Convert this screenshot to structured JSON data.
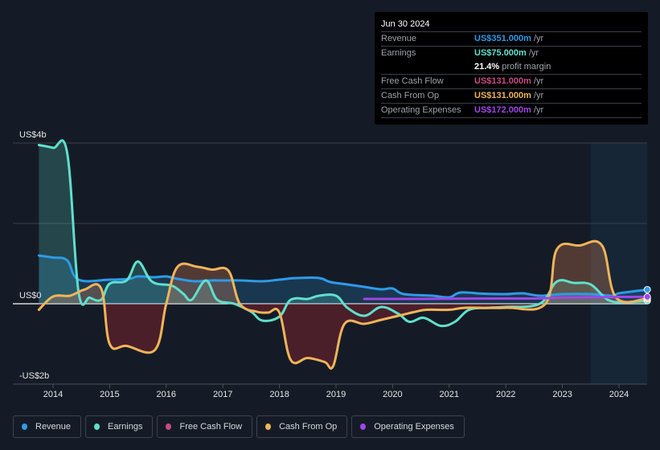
{
  "tooltip": {
    "date": "Jun 30 2024",
    "rows": [
      {
        "label": "Revenue",
        "value": "US$351.000m",
        "unit": "/yr",
        "color": "#2d9be8"
      },
      {
        "label": "Earnings",
        "value": "US$75.000m",
        "unit": "/yr",
        "color": "#5fe0cd"
      },
      {
        "label": "",
        "value": "21.4%",
        "unit": "profit margin",
        "color": "#ffffff"
      },
      {
        "label": "Free Cash Flow",
        "value": "US$131.000m",
        "unit": "/yr",
        "color": "#c94a84"
      },
      {
        "label": "Cash From Op",
        "value": "US$131.000m",
        "unit": "/yr",
        "color": "#f0b45a"
      },
      {
        "label": "Operating Expenses",
        "value": "US$172.000m",
        "unit": "/yr",
        "color": "#a046e8"
      }
    ]
  },
  "legend": [
    {
      "label": "Revenue",
      "color": "#2d9be8"
    },
    {
      "label": "Earnings",
      "color": "#5fe0cd"
    },
    {
      "label": "Free Cash Flow",
      "color": "#c94a84"
    },
    {
      "label": "Cash From Op",
      "color": "#f0b45a"
    },
    {
      "label": "Operating Expenses",
      "color": "#a046e8"
    }
  ],
  "chart_data": {
    "type": "area",
    "title": "",
    "xlabel": "",
    "ylabel": "",
    "units": "US$ billions",
    "ylim": [
      -2,
      4
    ],
    "xlim": [
      2013.75,
      2024.5
    ],
    "y_tick_labels": [
      {
        "value": 4,
        "label": "US$4b"
      },
      {
        "value": 0,
        "label": "US$0"
      },
      {
        "value": -2,
        "label": "-US$2b"
      }
    ],
    "gridlines": [
      4,
      2,
      0,
      -2
    ],
    "x_ticks": [
      2014,
      2015,
      2016,
      2017,
      2018,
      2019,
      2020,
      2021,
      2022,
      2023,
      2024
    ],
    "highlight_range": [
      2023.5,
      2024.5
    ],
    "legend_position": "bottom-left",
    "series": [
      {
        "name": "Revenue",
        "color": "#2d9be8",
        "fill": true,
        "points": [
          [
            2013.75,
            1.2
          ],
          [
            2014.0,
            1.15
          ],
          [
            2014.25,
            1.08
          ],
          [
            2014.45,
            0.6
          ],
          [
            2015.0,
            0.6
          ],
          [
            2015.35,
            0.62
          ],
          [
            2015.5,
            0.68
          ],
          [
            2015.8,
            0.66
          ],
          [
            2016.0,
            0.68
          ],
          [
            2016.2,
            0.62
          ],
          [
            2016.5,
            0.56
          ],
          [
            2016.8,
            0.58
          ],
          [
            2017.0,
            0.58
          ],
          [
            2017.3,
            0.58
          ],
          [
            2017.7,
            0.56
          ],
          [
            2018.0,
            0.6
          ],
          [
            2018.3,
            0.64
          ],
          [
            2018.7,
            0.64
          ],
          [
            2018.9,
            0.54
          ],
          [
            2019.2,
            0.48
          ],
          [
            2019.5,
            0.42
          ],
          [
            2019.8,
            0.36
          ],
          [
            2020.0,
            0.38
          ],
          [
            2020.2,
            0.24
          ],
          [
            2020.7,
            0.2
          ],
          [
            2021.0,
            0.16
          ],
          [
            2021.2,
            0.28
          ],
          [
            2021.6,
            0.25
          ],
          [
            2022.0,
            0.24
          ],
          [
            2022.3,
            0.26
          ],
          [
            2022.6,
            0.2
          ],
          [
            2023.0,
            0.24
          ],
          [
            2023.5,
            0.24
          ],
          [
            2023.9,
            0.2
          ],
          [
            2024.0,
            0.26
          ],
          [
            2024.5,
            0.351
          ]
        ]
      },
      {
        "name": "Earnings",
        "color": "#5fe0cd",
        "fill": true,
        "points": [
          [
            2013.75,
            3.95
          ],
          [
            2014.0,
            3.88
          ],
          [
            2014.25,
            3.75
          ],
          [
            2014.45,
            0.3
          ],
          [
            2014.65,
            0.15
          ],
          [
            2014.85,
            0.1
          ],
          [
            2015.0,
            0.5
          ],
          [
            2015.3,
            0.58
          ],
          [
            2015.5,
            1.05
          ],
          [
            2015.75,
            0.55
          ],
          [
            2016.1,
            0.45
          ],
          [
            2016.3,
            0.25
          ],
          [
            2016.45,
            0.1
          ],
          [
            2016.7,
            0.58
          ],
          [
            2016.9,
            0.1
          ],
          [
            2017.2,
            0.0
          ],
          [
            2017.5,
            -0.2
          ],
          [
            2017.7,
            -0.42
          ],
          [
            2018.0,
            -0.32
          ],
          [
            2018.2,
            0.1
          ],
          [
            2018.5,
            0.12
          ],
          [
            2018.7,
            0.2
          ],
          [
            2019.0,
            0.2
          ],
          [
            2019.2,
            -0.1
          ],
          [
            2019.5,
            -0.3
          ],
          [
            2019.8,
            -0.08
          ],
          [
            2020.1,
            -0.25
          ],
          [
            2020.3,
            -0.45
          ],
          [
            2020.55,
            -0.35
          ],
          [
            2020.85,
            -0.55
          ],
          [
            2021.1,
            -0.45
          ],
          [
            2021.35,
            -0.15
          ],
          [
            2021.7,
            -0.1
          ],
          [
            2022.0,
            -0.08
          ],
          [
            2022.6,
            0.0
          ],
          [
            2022.9,
            0.55
          ],
          [
            2023.2,
            0.52
          ],
          [
            2023.5,
            0.48
          ],
          [
            2023.8,
            0.1
          ],
          [
            2024.1,
            0.04
          ],
          [
            2024.5,
            0.075
          ]
        ]
      },
      {
        "name": "Free Cash Flow",
        "color": "#c94a84",
        "fill": true,
        "points": [
          [
            2013.75,
            -0.15
          ],
          [
            2014.0,
            0.18
          ],
          [
            2014.3,
            0.2
          ],
          [
            2014.55,
            0.35
          ],
          [
            2014.85,
            0.38
          ],
          [
            2015.0,
            -1.0
          ],
          [
            2015.3,
            -1.05
          ],
          [
            2015.8,
            -1.15
          ],
          [
            2016.0,
            0.0
          ],
          [
            2016.2,
            0.92
          ],
          [
            2016.55,
            0.92
          ],
          [
            2016.8,
            0.85
          ],
          [
            2017.1,
            0.82
          ],
          [
            2017.3,
            0.0
          ],
          [
            2017.6,
            -0.2
          ],
          [
            2017.8,
            -0.22
          ],
          [
            2018.0,
            -0.22
          ],
          [
            2018.2,
            -1.4
          ],
          [
            2018.5,
            -1.35
          ],
          [
            2018.8,
            -1.45
          ],
          [
            2018.95,
            -1.55
          ],
          [
            2019.15,
            -0.5
          ],
          [
            2019.5,
            -0.5
          ],
          [
            2019.8,
            -0.4
          ],
          [
            2020.1,
            -0.3
          ],
          [
            2020.4,
            -0.2
          ],
          [
            2020.6,
            -0.15
          ],
          [
            2021.0,
            -0.15
          ],
          [
            2021.3,
            -0.1
          ],
          [
            2022.0,
            -0.1
          ],
          [
            2022.7,
            0.0
          ],
          [
            2022.9,
            1.35
          ],
          [
            2023.3,
            1.45
          ],
          [
            2023.7,
            1.45
          ],
          [
            2023.95,
            0.15
          ],
          [
            2024.5,
            0.131
          ]
        ]
      },
      {
        "name": "Cash From Op",
        "color": "#f0b45a",
        "fill": true,
        "points": [
          [
            2013.75,
            -0.15
          ],
          [
            2014.0,
            0.18
          ],
          [
            2014.3,
            0.2
          ],
          [
            2014.55,
            0.35
          ],
          [
            2014.85,
            0.38
          ],
          [
            2015.0,
            -1.0
          ],
          [
            2015.3,
            -1.05
          ],
          [
            2015.8,
            -1.15
          ],
          [
            2016.0,
            0.0
          ],
          [
            2016.2,
            0.92
          ],
          [
            2016.55,
            0.92
          ],
          [
            2016.8,
            0.85
          ],
          [
            2017.1,
            0.82
          ],
          [
            2017.3,
            0.0
          ],
          [
            2017.6,
            -0.2
          ],
          [
            2017.8,
            -0.22
          ],
          [
            2018.0,
            -0.22
          ],
          [
            2018.2,
            -1.4
          ],
          [
            2018.5,
            -1.35
          ],
          [
            2018.8,
            -1.45
          ],
          [
            2018.95,
            -1.55
          ],
          [
            2019.15,
            -0.5
          ],
          [
            2019.5,
            -0.5
          ],
          [
            2019.8,
            -0.4
          ],
          [
            2020.1,
            -0.3
          ],
          [
            2020.4,
            -0.2
          ],
          [
            2020.6,
            -0.15
          ],
          [
            2021.0,
            -0.15
          ],
          [
            2021.3,
            -0.1
          ],
          [
            2022.0,
            -0.1
          ],
          [
            2022.7,
            0.0
          ],
          [
            2022.9,
            1.35
          ],
          [
            2023.3,
            1.45
          ],
          [
            2023.7,
            1.45
          ],
          [
            2023.95,
            0.15
          ],
          [
            2024.5,
            0.131
          ]
        ]
      },
      {
        "name": "Operating Expenses",
        "color": "#a046e8",
        "fill": false,
        "points": [
          [
            2019.5,
            0.12
          ],
          [
            2020.5,
            0.12
          ],
          [
            2021.5,
            0.13
          ],
          [
            2022.5,
            0.13
          ],
          [
            2023.0,
            0.15
          ],
          [
            2023.5,
            0.16
          ],
          [
            2024.0,
            0.17
          ],
          [
            2024.5,
            0.172
          ]
        ]
      }
    ]
  }
}
